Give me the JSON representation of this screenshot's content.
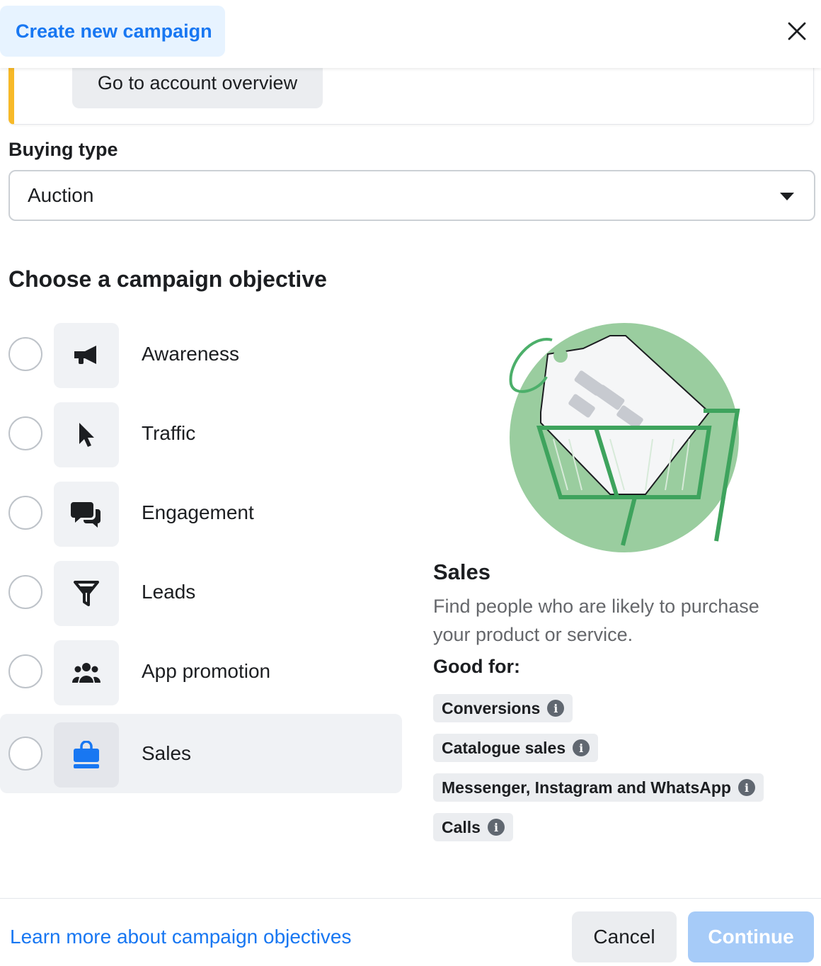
{
  "header": {
    "title": "Create new campaign"
  },
  "notice": {
    "button_label": "Go to account overview"
  },
  "buying_type": {
    "label": "Buying type",
    "value": "Auction"
  },
  "objective_section": {
    "title": "Choose a campaign objective"
  },
  "objectives": [
    {
      "label": "Awareness",
      "icon": "megaphone-icon",
      "selected": false
    },
    {
      "label": "Traffic",
      "icon": "cursor-icon",
      "selected": false
    },
    {
      "label": "Engagement",
      "icon": "chat-bubbles-icon",
      "selected": false
    },
    {
      "label": "Leads",
      "icon": "funnel-icon",
      "selected": false
    },
    {
      "label": "App promotion",
      "icon": "people-group-icon",
      "selected": false
    },
    {
      "label": "Sales",
      "icon": "shopping-bag-icon",
      "selected": true
    }
  ],
  "detail": {
    "title": "Sales",
    "description": "Find people who are likely to purchase your product or service.",
    "good_for_label": "Good for:",
    "tags": [
      "Conversions",
      "Catalogue sales",
      "Messenger, Instagram and WhatsApp",
      "Calls"
    ],
    "illustration": "shopping-cart-price-tag-illustration"
  },
  "footer": {
    "learn_more": "Learn more about campaign objectives",
    "cancel": "Cancel",
    "continue": "Continue"
  },
  "colors": {
    "accent": "#1877f2",
    "accent_light": "#e7f3ff",
    "warning_border": "#f7b928",
    "continue_disabled": "#a6cbf8",
    "illustration_green": "#9acd9f"
  }
}
